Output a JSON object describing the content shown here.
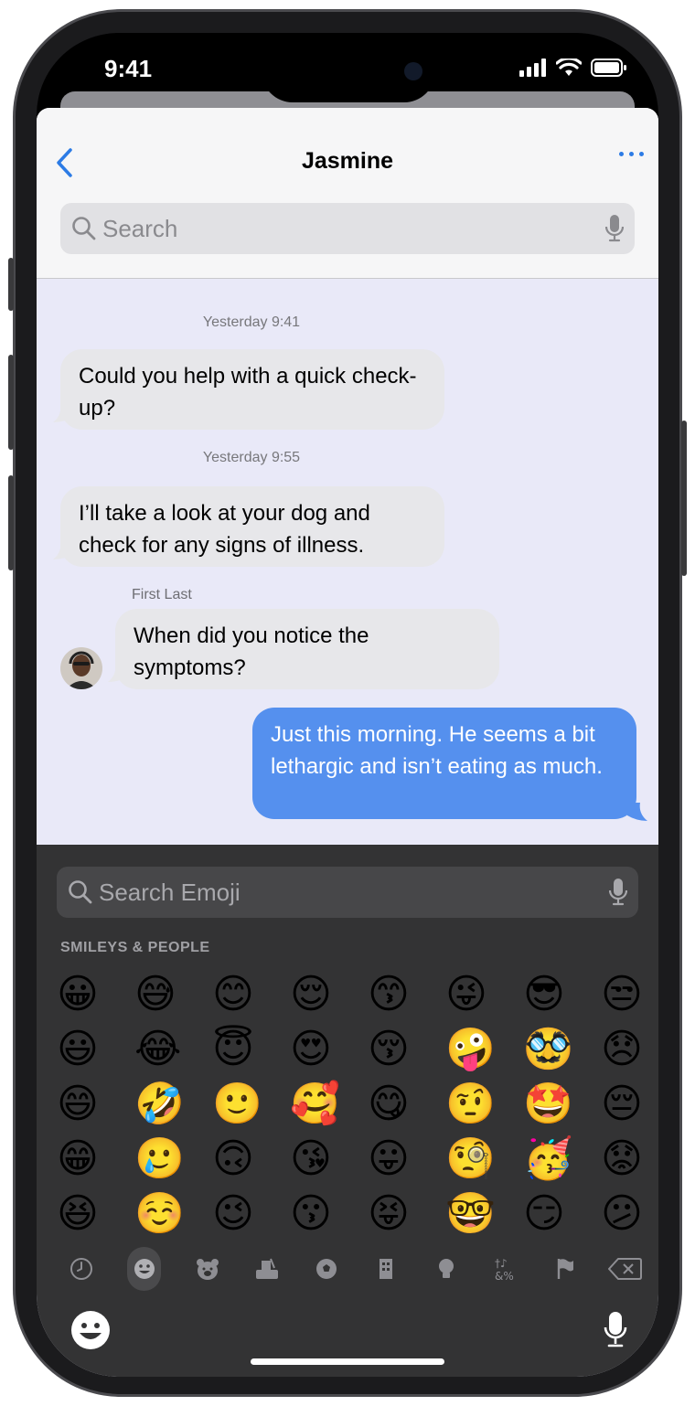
{
  "status": {
    "time": "9:41"
  },
  "header": {
    "title": "Jasmine",
    "search_placeholder": "Search"
  },
  "messages": [
    {
      "timestamp": "Yesterday 9:41",
      "text": "Could you help with a quick check-up?"
    },
    {
      "timestamp": "Yesterday 9:55",
      "text": "I’ll take a look at your dog and check for any signs of illness."
    },
    {
      "sender": "First Last",
      "text": "When did you notice the symptoms?"
    },
    {
      "text": "Just this morning. He seems a bit lethargic and isn’t eating as much."
    }
  ],
  "keyboard": {
    "search_placeholder": "Search Emoji",
    "section_label": "SMILEYS & PEOPLE",
    "emojis": [
      "😀",
      "😅",
      "😊",
      "😌",
      "😙",
      "😜",
      "😎",
      "😒",
      "😃",
      "😂",
      "😇",
      "😍",
      "😚",
      "🤪",
      "🥸",
      "😞",
      "😄",
      "🤣",
      "🙂",
      "🥰",
      "😋",
      "🤨",
      "🤩",
      "😔",
      "😁",
      "🥲",
      "🙃",
      "😘",
      "😛",
      "🧐",
      "🥳",
      "😟",
      "😆",
      "☺️",
      "😉",
      "😗",
      "😝",
      "🤓",
      "😏",
      "😕"
    ],
    "categories": [
      "clock-icon",
      "smiley-icon",
      "bear-icon",
      "food-icon",
      "ball-icon",
      "building-icon",
      "lightbulb-icon",
      "symbols-icon",
      "flag-icon",
      "delete-icon"
    ]
  },
  "colors": {
    "accent": "#2c7be5",
    "outgoing_bubble": "#5590ee",
    "incoming_bubble": "#e7e7ea",
    "chat_bg": "#e9e9f8",
    "keyboard_bg": "#333334"
  }
}
